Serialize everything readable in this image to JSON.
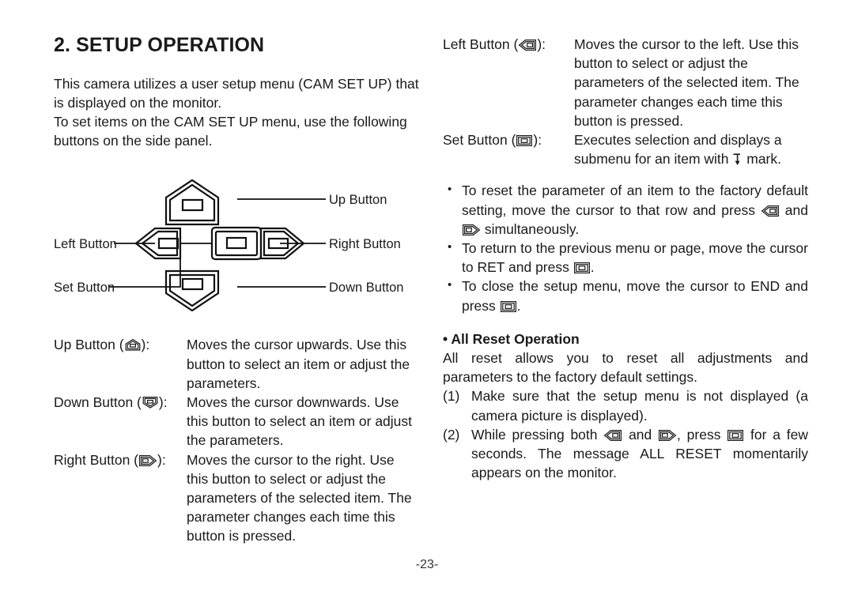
{
  "document": {
    "title": "2. SETUP OPERATION",
    "page_number": "-23-"
  },
  "left_column": {
    "intro_paragraph_1": "This camera utilizes a user setup menu (CAM SET UP) that is displayed on the monitor.",
    "intro_paragraph_2": "To set items on the CAM SET UP menu, use the following buttons on the side panel.",
    "diagram": {
      "labels": {
        "up": "Up Button",
        "right": "Right Button",
        "down": "Down Button",
        "left": "Left Button",
        "set": "Set Button"
      }
    },
    "definitions": [
      {
        "term_prefix": "Up Button (",
        "icon": "up-button-icon",
        "term_suffix": "):",
        "description": "Moves the cursor upwards. Use this button to select an item or adjust the parameters."
      },
      {
        "term_prefix": "Down Button (",
        "icon": "down-button-icon",
        "term_suffix": "):",
        "description": "Moves the cursor downwards. Use this button to select an item or adjust the parameters."
      },
      {
        "term_prefix": "Right Button (",
        "icon": "right-button-icon",
        "term_suffix": "):",
        "description": "Moves the cursor to the right. Use this button to select or adjust the parameters of the selected item. The parameter changes each time this button is pressed."
      }
    ]
  },
  "right_column": {
    "definitions": [
      {
        "term_prefix": "Left Button (",
        "icon": "left-button-icon",
        "term_suffix": "):",
        "description": "Moves the cursor to the left. Use this button to select or adjust the parameters of the selected item. The parameter changes each time this button is pressed."
      },
      {
        "term_prefix": "Set Button (",
        "icon": "set-button-icon",
        "term_suffix": "):",
        "description_part1": "Executes selection and displays a submenu for an item with ",
        "description_part2": " mark.",
        "inline_icon": "submenu-mark-icon"
      }
    ],
    "bullets": [
      {
        "part1": "To reset the parameter of an item to the factory default setting, move the cursor to that row and press ",
        "icon1": "left-button-icon",
        "part2": " and ",
        "icon2": "right-button-icon",
        "part3": " simultaneously."
      },
      {
        "part1": "To return to the previous menu or page, move the cursor to RET and press ",
        "icon1": "set-button-icon",
        "part2": "."
      },
      {
        "part1": "To close the setup menu, move the cursor to END and press ",
        "icon1": "set-button-icon",
        "part2": "."
      }
    ],
    "all_reset": {
      "heading": "• All Reset Operation",
      "intro": "All reset allows you to reset all adjustments and parameters to the factory default settings.",
      "steps": [
        {
          "num": "(1)",
          "text": "Make sure that the setup menu is not displayed (a camera picture is displayed)."
        },
        {
          "num": "(2)",
          "part1": "While pressing both ",
          "icon1": "left-button-icon",
          "part2": " and ",
          "icon2": "right-button-icon",
          "part3": ", press ",
          "icon3": "set-button-icon",
          "part4": " for a few seconds. The message ALL RESET momentarily appears on the monitor."
        }
      ]
    }
  }
}
